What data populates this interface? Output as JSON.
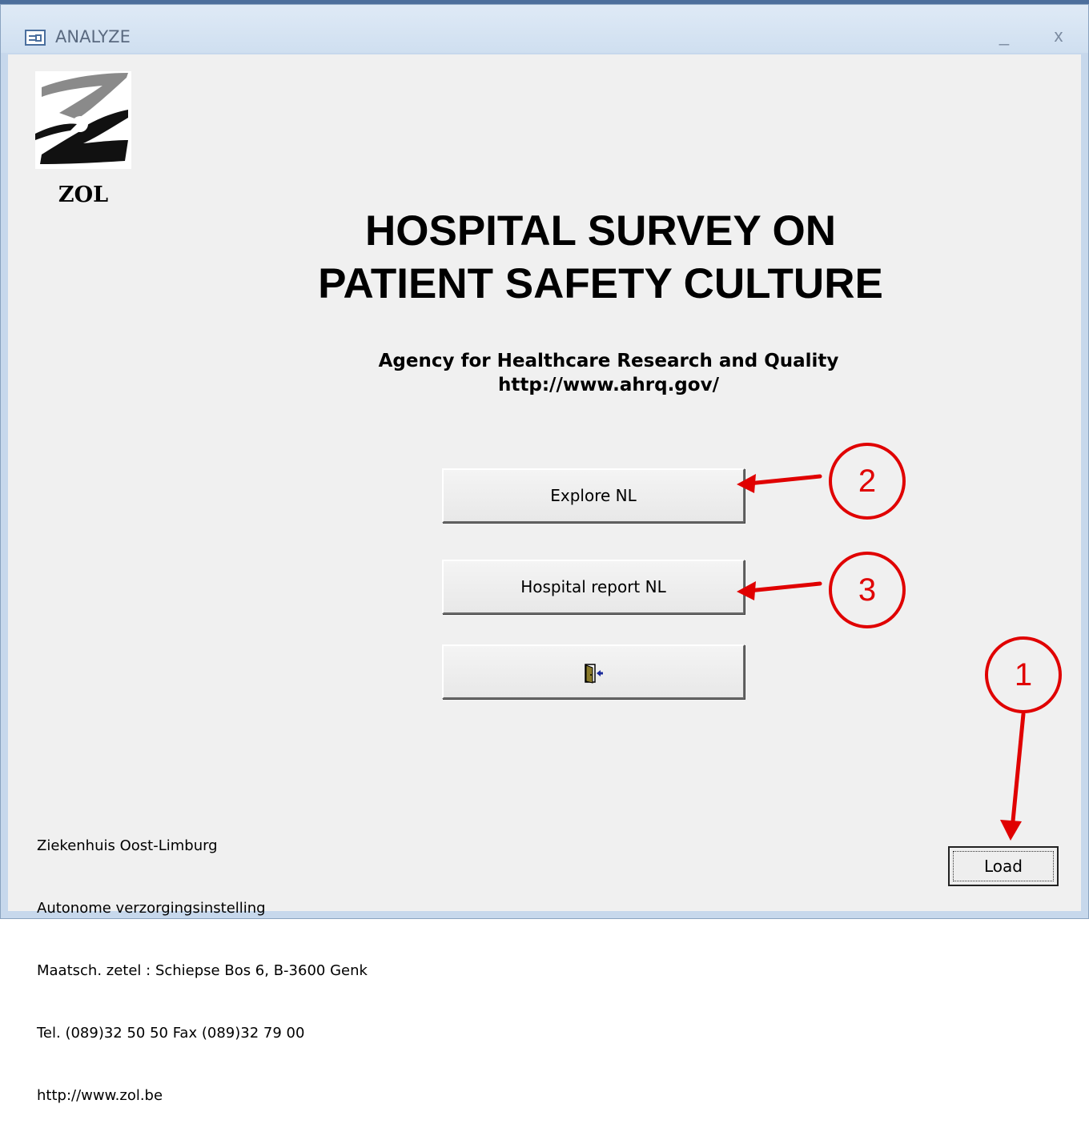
{
  "window": {
    "title": "ANALYZE",
    "minimize_glyph": "_",
    "close_glyph": "x"
  },
  "logo": {
    "caption": "ZOL",
    "icon": "zol-logo"
  },
  "heading": {
    "line1": "HOSPITAL SURVEY ON",
    "line2": "PATIENT SAFETY CULTURE"
  },
  "agency": {
    "name": "Agency for Healthcare Research and Quality",
    "url": "http://www.ahrq.gov/"
  },
  "buttons": {
    "explore_label": "Explore NL",
    "report_label": "Hospital report NL",
    "exit_icon": "exit-door-icon",
    "load_label": "Load"
  },
  "footer": {
    "lines": [
      "Ziekenhuis Oost-Limburg",
      "Autonome verzorgingsinstelling",
      "Maatsch. zetel : Schiepse Bos 6, B-3600 Genk",
      "Tel. (089)32 50 50 Fax (089)32 79 00",
      "http://www.zol.be"
    ]
  },
  "annotations": {
    "marker1": "1",
    "marker2": "2",
    "marker3": "3",
    "color": "#e00000"
  }
}
